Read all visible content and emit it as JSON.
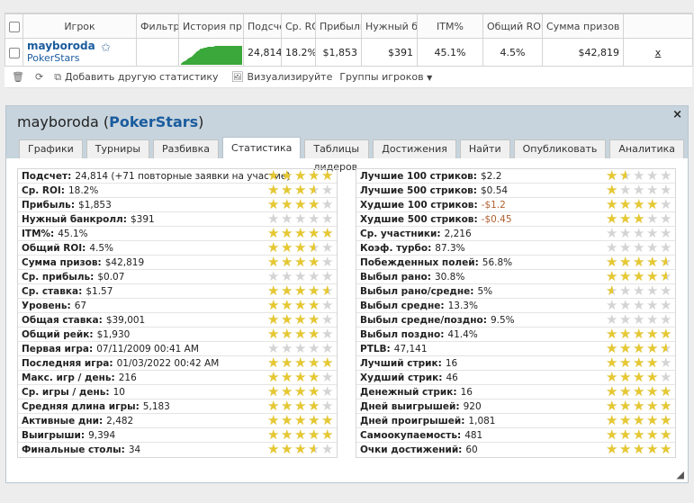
{
  "top_table": {
    "headers": [
      "Игрок",
      "Фильтр",
      "История пр",
      "Подсчет",
      "Ср. RO",
      "Прибыль",
      "Нужный б",
      "ITM%",
      "Общий ROI",
      "Сумма призов"
    ],
    "row": {
      "player_name": "mayboroda",
      "site": "PokerStars",
      "values": [
        "24,814",
        "18.2%",
        "$1,853",
        "$391",
        "45.1%",
        "4.5%",
        "$42,819"
      ],
      "remove_label": "x"
    }
  },
  "toolbar": {
    "add_stat_label": "Добавить другую статистику",
    "visualize_label": "Визуализируйте",
    "groups_label": "Группы игроков"
  },
  "panel": {
    "player_name": "mayboroda",
    "site": "PokerStars",
    "close_label": "×",
    "tabs": [
      "Графики",
      "Турниры",
      "Разбивка",
      "Статистика",
      "Таблицы лидеров",
      "Достижения",
      "Найти",
      "Опубликовать",
      "Аналитика"
    ],
    "active_tab": 3,
    "left_stats": [
      {
        "label": "Подсчет:",
        "value": "24,814 (+71 повторные заявки на участие)",
        "rating": 5.0
      },
      {
        "label": "Ср. ROI:",
        "value": "18.2%",
        "rating": 3.5
      },
      {
        "label": "Прибыль:",
        "value": "$1,853",
        "rating": 4.0
      },
      {
        "label": "Нужный банкролл:",
        "value": "$391",
        "rating": 0
      },
      {
        "label": "ITM%:",
        "value": "45.1%",
        "rating": 5.0
      },
      {
        "label": "Общий ROI:",
        "value": "4.5%",
        "rating": 3.5
      },
      {
        "label": "Сумма призов:",
        "value": "$42,819",
        "rating": 4.0
      },
      {
        "label": "Ср. прибыль:",
        "value": "$0.07",
        "rating": 0
      },
      {
        "label": "Ср. ставка:",
        "value": "$1.57",
        "rating": 4.5
      },
      {
        "label": "Уровень:",
        "value": "67",
        "rating": 4.0
      },
      {
        "label": "Общая ставка:",
        "value": "$39,001",
        "rating": 4.0
      },
      {
        "label": "Общий рейк:",
        "value": "$1,930",
        "rating": 4.0
      },
      {
        "label": "Первая игра:",
        "value": "07/11/2009 00:41 AM",
        "rating": 0
      },
      {
        "label": "Последняя игра:",
        "value": "01/03/2022 00:42 AM",
        "rating": 5.0
      },
      {
        "label": "Макс. игр / день:",
        "value": "216",
        "rating": 4.0
      },
      {
        "label": "Ср. игры / день:",
        "value": "10",
        "rating": 4.0
      },
      {
        "label": "Средняя длина игры:",
        "value": "5,183",
        "rating": 4.0
      },
      {
        "label": "Активные дни:",
        "value": "2,482",
        "rating": 5.0
      },
      {
        "label": "Выигрыши:",
        "value": "9,394",
        "rating": 5.0
      },
      {
        "label": "Финальные столы:",
        "value": "34",
        "rating": 3.5
      }
    ],
    "right_stats": [
      {
        "label": "Лучшие 100 стриков:",
        "value": "$2.2",
        "negative": false,
        "rating": 1.5
      },
      {
        "label": "Лучшие 500 стриков:",
        "value": "$0.54",
        "negative": false,
        "rating": 1.0
      },
      {
        "label": "Худшие 100 стриков:",
        "value": "-$1.2",
        "negative": true,
        "rating": 4.0
      },
      {
        "label": "Худшие 500 стриков:",
        "value": "-$0.45",
        "negative": true,
        "rating": 3.0
      },
      {
        "label": "Ср. участники:",
        "value": "2,216",
        "negative": false,
        "rating": 0
      },
      {
        "label": "Коэф. турбо:",
        "value": "87.3%",
        "negative": false,
        "rating": 0
      },
      {
        "label": "Побежденных полей:",
        "value": "56.8%",
        "negative": false,
        "rating": 4.5
      },
      {
        "label": "Выбыл рано:",
        "value": "30.8%",
        "negative": false,
        "rating": 4.5
      },
      {
        "label": "Выбыл рано/средне:",
        "value": "5%",
        "negative": false,
        "rating": 0.5
      },
      {
        "label": "Выбыл средне:",
        "value": "13.3%",
        "negative": false,
        "rating": 0
      },
      {
        "label": "Выбыл средне/поздно:",
        "value": "9.5%",
        "negative": false,
        "rating": 0
      },
      {
        "label": "Выбыл поздно:",
        "value": "41.4%",
        "negative": false,
        "rating": 5.0
      },
      {
        "label": "PTLB:",
        "value": "47,141",
        "negative": false,
        "rating": 4.5
      },
      {
        "label": "Лучший стрик:",
        "value": "16",
        "negative": false,
        "rating": 4.0
      },
      {
        "label": "Худший стрик:",
        "value": "46",
        "negative": false,
        "rating": 4.0
      },
      {
        "label": "Денежный стрик:",
        "value": "16",
        "negative": false,
        "rating": 5.0
      },
      {
        "label": "Дней выигрышей:",
        "value": "920",
        "negative": false,
        "rating": 5.0
      },
      {
        "label": "Дней проигрышей:",
        "value": "1,081",
        "negative": false,
        "rating": 5.0
      },
      {
        "label": "Самоокупаемость:",
        "value": "481",
        "negative": false,
        "rating": 5.0
      },
      {
        "label": "Очки достижений:",
        "value": "60",
        "negative": false,
        "rating": 5.0
      }
    ]
  },
  "colors": {
    "link": "#1a5c9e",
    "panel_header": "#c7d4dd",
    "star_filled": "#e6c832",
    "star_empty": "#d4d4d4",
    "sparkline": "#3aa83a",
    "negative": "#b06030"
  }
}
